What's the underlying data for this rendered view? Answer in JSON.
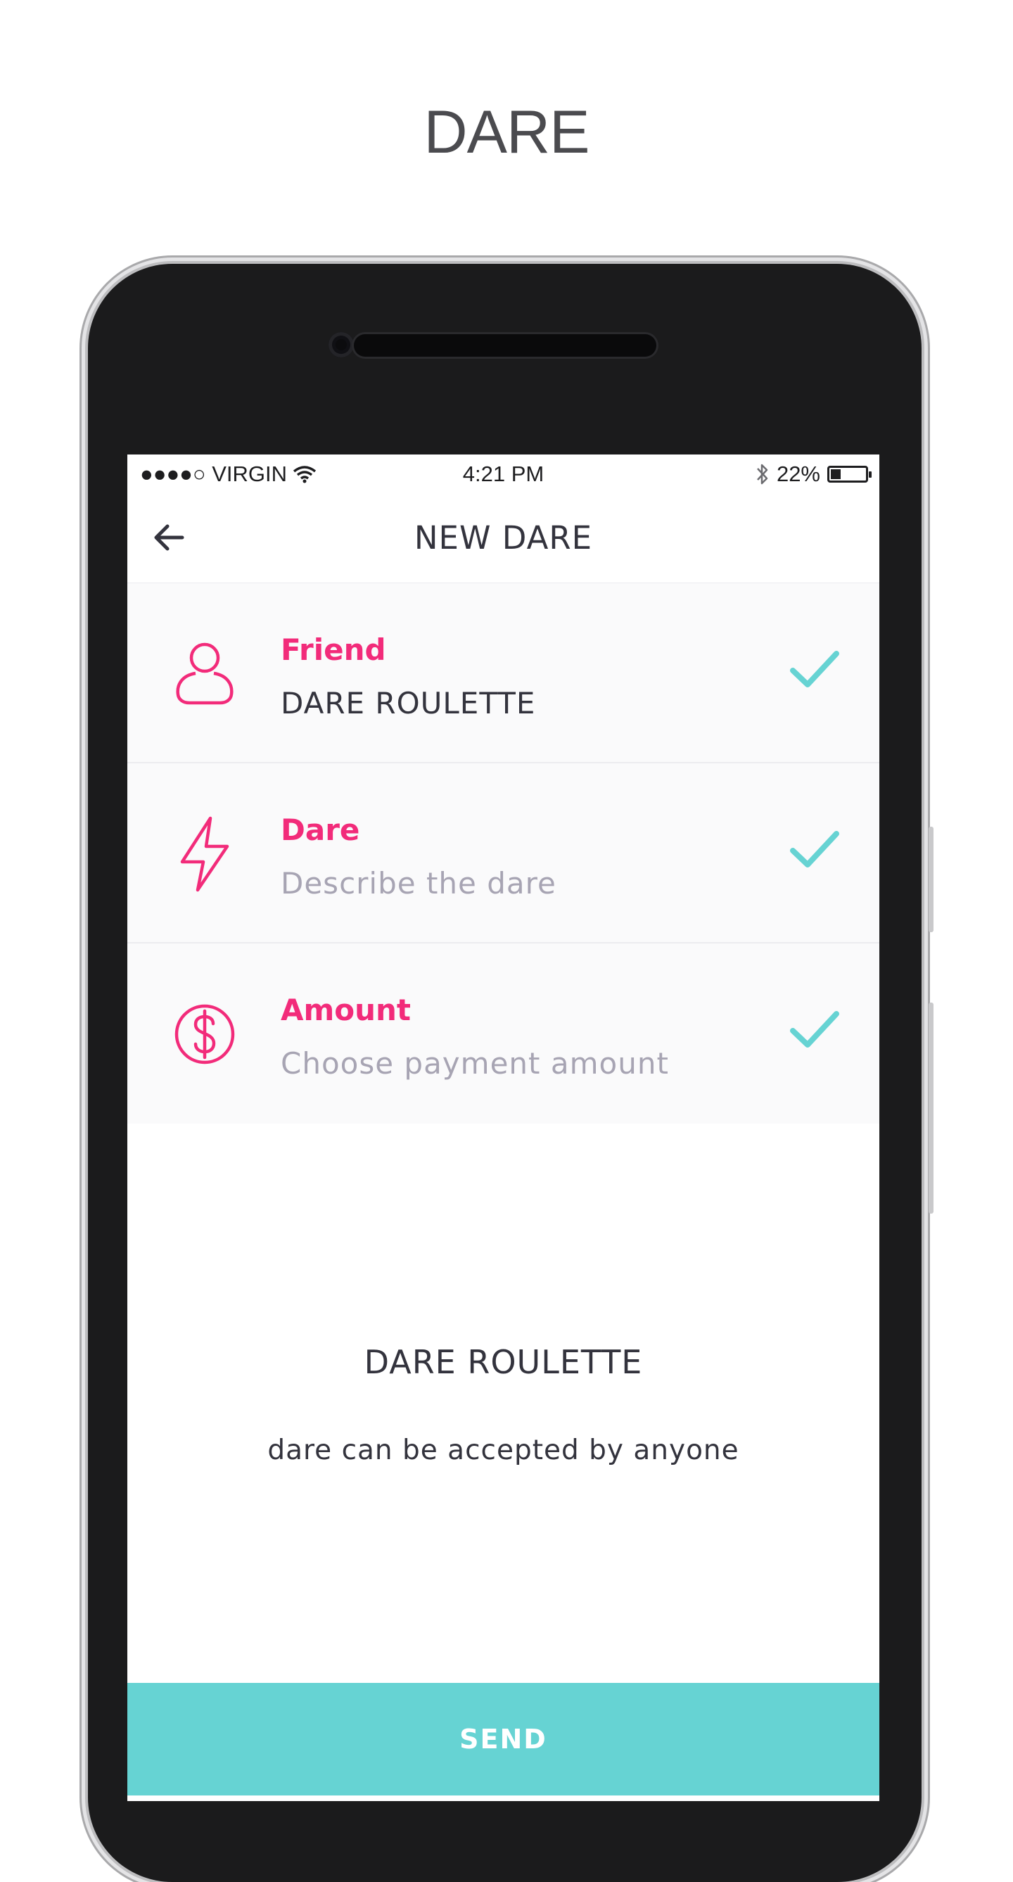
{
  "page": {
    "headline": "DARE"
  },
  "status_bar": {
    "carrier": "●●●●○ VIRGIN",
    "time": "4:21 PM",
    "battery": "22%"
  },
  "nav": {
    "title": "NEW DARE"
  },
  "rows": [
    {
      "label": "Friend",
      "value": "DARE ROULETTE",
      "icon": "user-icon"
    },
    {
      "label": "Dare",
      "value": "Describe the dare",
      "icon": "lightning-icon"
    },
    {
      "label": "Amount",
      "value": "Choose payment amount",
      "icon": "dollar-icon"
    }
  ],
  "info": {
    "title": "DARE ROULETTE",
    "subtitle": "dare can be accepted by anyone"
  },
  "actions": {
    "send_label": "SEND"
  },
  "colors": {
    "accent_pink": "#f22b7a",
    "accent_teal": "#66d3d3",
    "text_dark": "#33333d",
    "placeholder": "#a7a4b3"
  }
}
